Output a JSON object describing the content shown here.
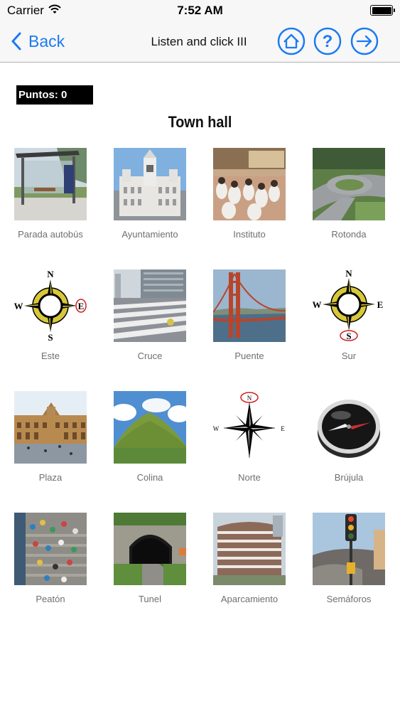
{
  "status_bar": {
    "carrier": "Carrier",
    "time": "7:52 AM"
  },
  "nav": {
    "back_label": "Back",
    "title": "Listen and click III",
    "home_icon": "home-icon",
    "help_icon": "help-icon",
    "next_icon": "arrow-right-icon"
  },
  "score": {
    "label": "Puntos: 0"
  },
  "prompt": {
    "word": "Town hall"
  },
  "colors": {
    "accent": "#1a7bf2",
    "score_bg": "#000000",
    "label_gray": "#6f6f6f"
  },
  "tiles": [
    {
      "label": "Parada autobús",
      "image": "bus-stop-photo"
    },
    {
      "label": "Ayuntamiento",
      "image": "town-hall-photo"
    },
    {
      "label": "Instituto",
      "image": "school-photo"
    },
    {
      "label": "Rotonda",
      "image": "roundabout-photo"
    },
    {
      "label": "Este",
      "image": "compass-rose-east-photo",
      "compass": {
        "N": "N",
        "S": "S",
        "E": "E",
        "W": "W"
      }
    },
    {
      "label": "Cruce",
      "image": "crosswalk-photo"
    },
    {
      "label": "Puente",
      "image": "bridge-photo"
    },
    {
      "label": "Sur",
      "image": "compass-rose-south-photo"
    },
    {
      "label": "Plaza",
      "image": "plaza-photo"
    },
    {
      "label": "Colina",
      "image": "hill-photo"
    },
    {
      "label": "Norte",
      "image": "compass-rose-north-photo"
    },
    {
      "label": "Brújula",
      "image": "compass-photo"
    },
    {
      "label": "Peatón",
      "image": "pedestrians-photo"
    },
    {
      "label": "Tunel",
      "image": "tunnel-photo"
    },
    {
      "label": "Aparcamiento",
      "image": "parking-garage-photo"
    },
    {
      "label": "Semáforos",
      "image": "traffic-light-photo"
    }
  ]
}
